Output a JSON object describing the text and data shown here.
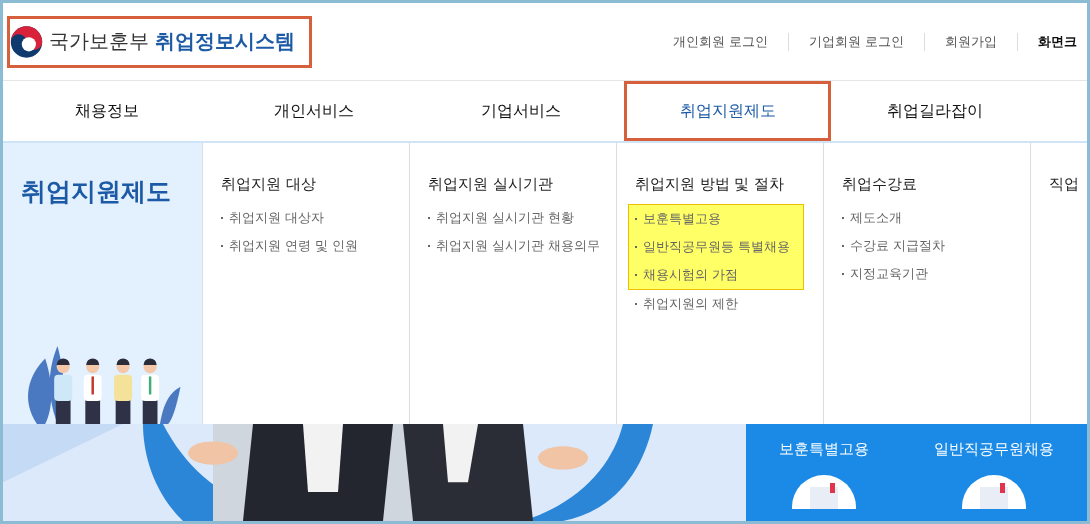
{
  "logo": {
    "org": "국가보훈부",
    "system": "취업정보시스템",
    "outlined": true
  },
  "top_links": [
    {
      "label": "개인회원 로그인",
      "bold": false
    },
    {
      "label": "기업회원 로그인",
      "bold": false
    },
    {
      "label": "회원가입",
      "bold": false
    },
    {
      "label": "화면크",
      "bold": true
    }
  ],
  "nav": [
    {
      "label": "채용정보",
      "selected": false
    },
    {
      "label": "개인서비스",
      "selected": false
    },
    {
      "label": "기업서비스",
      "selected": false
    },
    {
      "label": "취업지원제도",
      "selected": true
    },
    {
      "label": "취업길라잡이",
      "selected": false
    }
  ],
  "menu": {
    "title": "취업지원제도",
    "columns": [
      {
        "heading": "취업지원 대상",
        "items": [
          {
            "label": "취업지원 대상자",
            "highlighted": false
          },
          {
            "label": "취업지원 연령 및 인원",
            "highlighted": false
          }
        ]
      },
      {
        "heading": "취업지원 실시기관",
        "items": [
          {
            "label": "취업지원 실시기관 현황",
            "highlighted": false
          },
          {
            "label": "취업지원 실시기관 채용의무",
            "highlighted": false
          }
        ]
      },
      {
        "heading": "취업지원 방법 및 절차",
        "items": [
          {
            "label": "보훈특별고용",
            "highlighted": true
          },
          {
            "label": "일반직공무원등 특별채용",
            "highlighted": true
          },
          {
            "label": "채용시험의 가점",
            "highlighted": true
          },
          {
            "label": "취업지원의 제한",
            "highlighted": false
          }
        ]
      },
      {
        "heading": "취업수강료",
        "items": [
          {
            "label": "제도소개",
            "highlighted": false
          },
          {
            "label": "수강료 지급절차",
            "highlighted": false
          },
          {
            "label": "지정교육기관",
            "highlighted": false
          }
        ]
      },
      {
        "heading": "직업"
      }
    ]
  },
  "banner": {
    "cards": [
      "보훈특별고용",
      "일반직공무원채용"
    ]
  }
}
